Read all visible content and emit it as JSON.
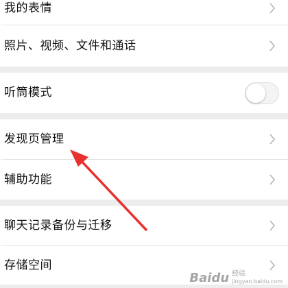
{
  "settings": {
    "items": [
      {
        "label": "我的表情"
      },
      {
        "label": "照片、视频、文件和通话"
      },
      {
        "label": "听筒模式"
      },
      {
        "label": "发现页管理"
      },
      {
        "label": "辅助功能"
      },
      {
        "label": "聊天记录备份与迁移"
      },
      {
        "label": "存储空间"
      }
    ],
    "earpiece_mode_on": false
  },
  "annotation": {
    "arrow_color": "#e8312e",
    "points_to": "发现页管理"
  },
  "watermark": {
    "brand": "Baidu",
    "sub": "经验",
    "url": "jingyan.baidu.com"
  },
  "icons": {
    "chevron": "chevron-right-icon",
    "arrow": "red-annotation-arrow"
  }
}
